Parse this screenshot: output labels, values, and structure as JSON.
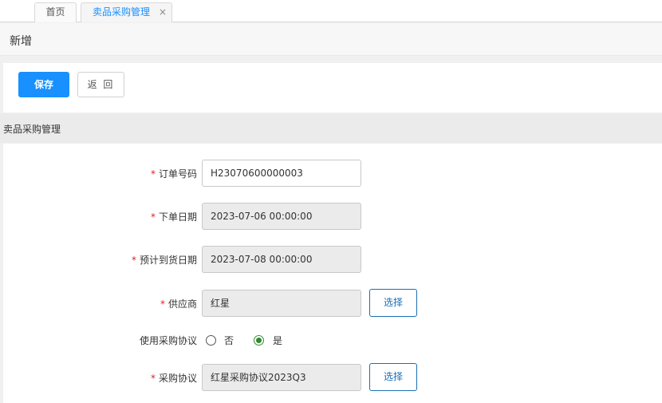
{
  "tabs": [
    {
      "label": "首页"
    },
    {
      "label": "卖品采购管理",
      "close": "×"
    }
  ],
  "page": {
    "title": "新增"
  },
  "toolbar": {
    "save_label": "保存",
    "back_label": "返 回"
  },
  "section": {
    "title": "卖品采购管理"
  },
  "form": {
    "required_mark": "*",
    "order_no": {
      "label": "订单号码",
      "value": "H23070600000003"
    },
    "order_date": {
      "label": "下单日期",
      "value": "2023-07-06 00:00:00"
    },
    "expected_date": {
      "label": "预计到货日期",
      "value": "2023-07-08 00:00:00"
    },
    "supplier": {
      "label": "供应商",
      "value": "红星",
      "button": "选择"
    },
    "use_agreement": {
      "label": "使用采购协议",
      "options": [
        "否",
        "是"
      ],
      "selected": "是"
    },
    "agreement": {
      "label": "采购协议",
      "value": "红星采购协议2023Q3",
      "button": "选择"
    }
  },
  "colors": {
    "accent": "#1890ff",
    "required": "#e02020",
    "radio_selected": "#2e8b2e"
  }
}
